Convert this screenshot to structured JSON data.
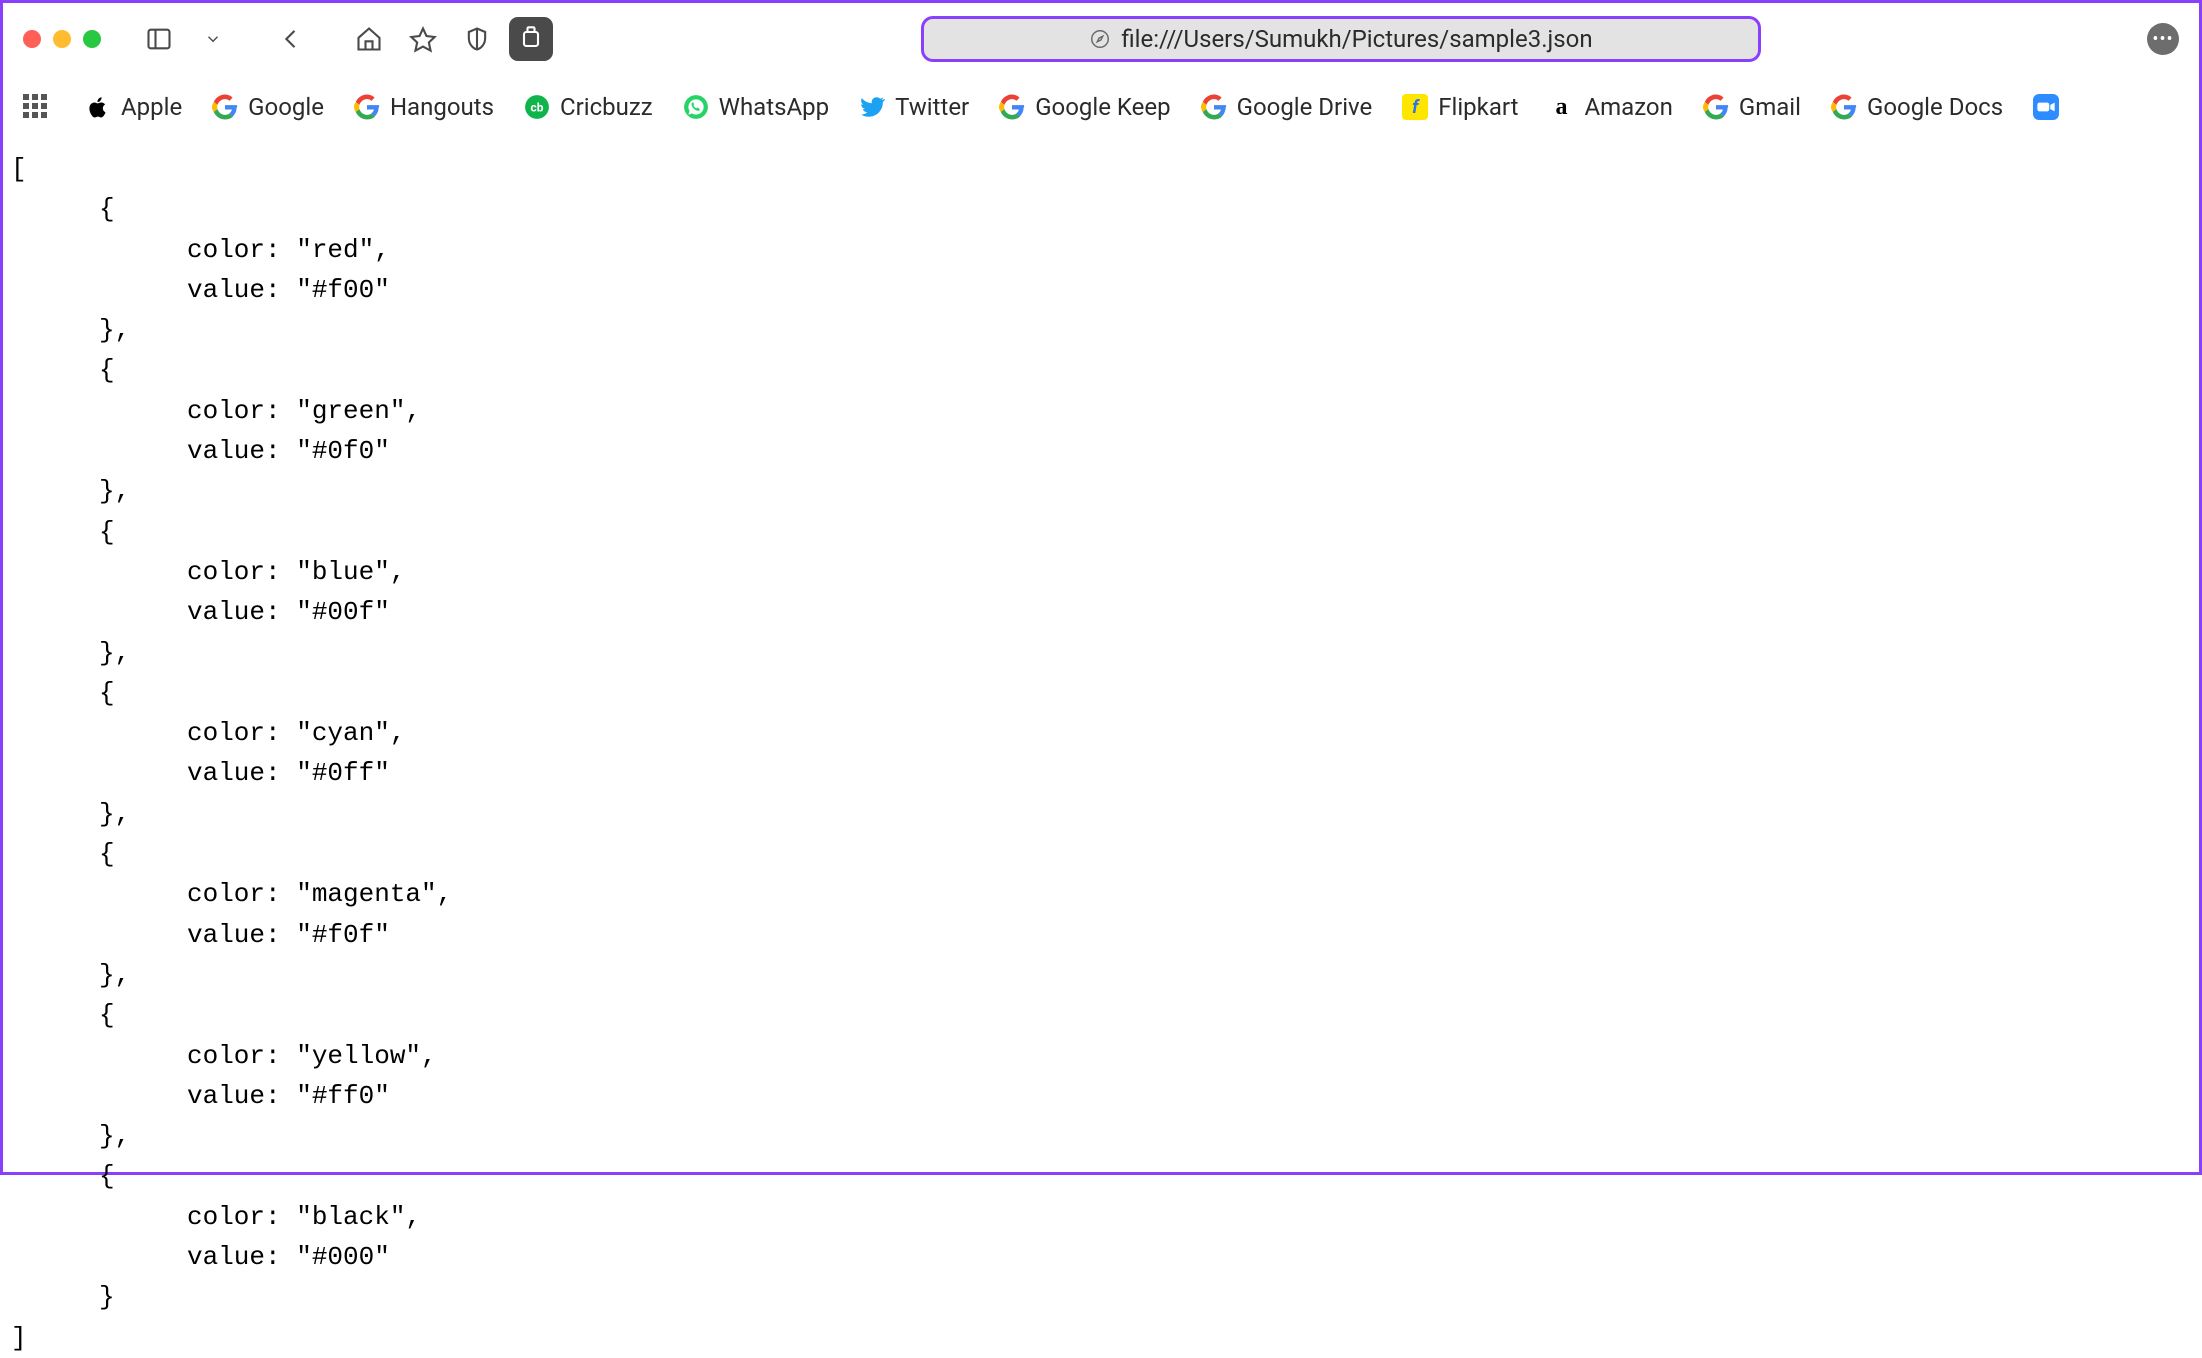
{
  "toolbar": {
    "url": "file:///Users/Sumukh/Pictures/sample3.json"
  },
  "favorites": {
    "items": [
      {
        "label": "Apple",
        "icon": "apple-icon"
      },
      {
        "label": "Google",
        "icon": "google-icon"
      },
      {
        "label": "Hangouts",
        "icon": "hangouts-icon"
      },
      {
        "label": "Cricbuzz",
        "icon": "cricbuzz-icon"
      },
      {
        "label": "WhatsApp",
        "icon": "whatsapp-icon"
      },
      {
        "label": "Twitter",
        "icon": "twitter-icon"
      },
      {
        "label": "Google Keep",
        "icon": "google-keep-icon"
      },
      {
        "label": "Google Drive",
        "icon": "google-drive-icon"
      },
      {
        "label": "Flipkart",
        "icon": "flipkart-icon"
      },
      {
        "label": "Amazon",
        "icon": "amazon-icon"
      },
      {
        "label": "Gmail",
        "icon": "gmail-icon"
      },
      {
        "label": "Google Docs",
        "icon": "google-docs-icon"
      }
    ]
  },
  "json_file": {
    "entries": [
      {
        "color": "red",
        "value": "#f00"
      },
      {
        "color": "green",
        "value": "#0f0"
      },
      {
        "color": "blue",
        "value": "#00f"
      },
      {
        "color": "cyan",
        "value": "#0ff"
      },
      {
        "color": "magenta",
        "value": "#f0f"
      },
      {
        "color": "yellow",
        "value": "#ff0"
      },
      {
        "color": "black",
        "value": "#000"
      }
    ],
    "key_color": "color",
    "key_value": "value"
  }
}
